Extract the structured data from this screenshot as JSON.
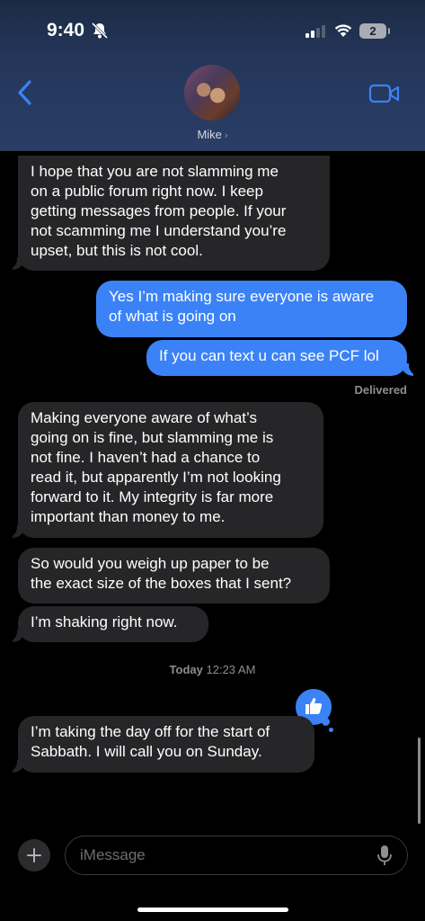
{
  "status_bar": {
    "time": "9:40",
    "battery": "2"
  },
  "header": {
    "contact_name": "Mike",
    "chevron": "›"
  },
  "messages": [
    {
      "dir": "in",
      "text": "I hope that you are not slamming me\non a public forum right now. I keep\ngetting messages from people.  If your\nnot scamming me I understand you’re\nupset, but this is not cool."
    },
    {
      "dir": "out",
      "text": "Yes I’m making sure everyone is aware\nof what is going on"
    },
    {
      "dir": "out",
      "text": "If you can text u can see PCF lol"
    },
    {
      "dir": "in",
      "text": "Making everyone aware of what’s\ngoing on is fine, but slamming me is\nnot fine. I haven’t had a chance to\nread it, but apparently I’m not looking\nforward to it.  My integrity is far more\nimportant than money to me."
    },
    {
      "dir": "in",
      "text": "So would you weigh up paper to be\nthe exact size of the boxes that I sent?"
    },
    {
      "dir": "in",
      "text": "I’m shaking right now."
    },
    {
      "dir": "in",
      "text": "I’m taking the day off for the start of\nSabbath. I will call you on Sunday."
    }
  ],
  "delivered_label": "Delivered",
  "timestamp": {
    "day": "Today",
    "time": "12:23 AM"
  },
  "reaction": {
    "icon": "thumbs-up-icon"
  },
  "composer": {
    "placeholder": "iMessage"
  },
  "colors": {
    "outgoing": "#3b82f7",
    "incoming": "#262628",
    "background": "#000000"
  }
}
